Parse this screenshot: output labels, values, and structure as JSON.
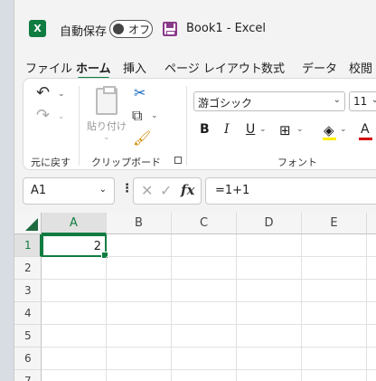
{
  "titlebar": {
    "app_icon": "X",
    "autosave_label": "自動保存",
    "autosave_state": "オフ",
    "doc_title": "Book1  -  Excel"
  },
  "tabs": [
    "ファイル",
    "ホーム",
    "挿入",
    "ページ レイアウト",
    "数式",
    "データ",
    "校閲"
  ],
  "active_tab": "ホーム",
  "ribbon": {
    "undo_group_label": "元に戻す",
    "paste_label": "貼り付け",
    "clipboard_group_label": "クリップボード",
    "font_name": "游ゴシック",
    "font_size": "11",
    "font_group_label": "フォント",
    "bold": "B",
    "italic": "I",
    "underline": "U",
    "font_color_glyph": "A",
    "highlight_color": "#ffee00",
    "font_color": "#d40000"
  },
  "formula_bar": {
    "name_box": "A1",
    "fx": "fx",
    "formula": "=1+1"
  },
  "grid": {
    "columns": [
      "A",
      "B",
      "C",
      "D",
      "E"
    ],
    "rows": [
      "1",
      "2",
      "3",
      "4",
      "5",
      "6",
      "7"
    ],
    "selected_cell": "A1",
    "cells": {
      "A1": "2"
    }
  },
  "colors": {
    "accent": "#107c41",
    "save_icon": "#8a3a8a"
  }
}
